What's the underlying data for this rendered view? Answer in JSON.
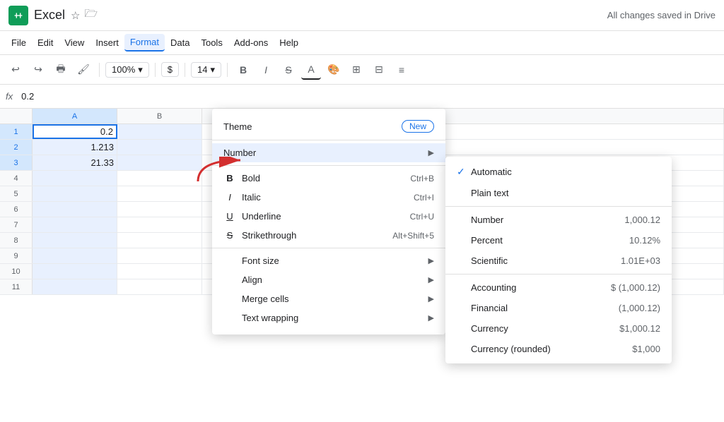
{
  "app": {
    "title": "Excel",
    "drive_status": "All changes saved in Drive",
    "icon_color": "#0f9d58"
  },
  "title_bar": {
    "app_name": "Excel",
    "star_icon": "☆",
    "folder_icon": "🗁"
  },
  "menu_bar": {
    "items": [
      "File",
      "Edit",
      "View",
      "Insert",
      "Format",
      "Data",
      "Tools",
      "Add-ons",
      "Help"
    ]
  },
  "toolbar": {
    "zoom": "100%",
    "currency_symbol": "$",
    "font_size": "14",
    "undo_icon": "↩",
    "redo_icon": "↪",
    "print_icon": "🖶",
    "paint_icon": "🖌",
    "bold": "B",
    "italic": "I",
    "strikethrough": "S",
    "underline": "A"
  },
  "formula_bar": {
    "fx": "fx",
    "cell_ref": "A1",
    "value": "0.2"
  },
  "spreadsheet": {
    "columns": [
      "A",
      "B"
    ],
    "rows": [
      {
        "num": 1,
        "a": "0.2",
        "b": ""
      },
      {
        "num": 2,
        "a": "1.213",
        "b": ""
      },
      {
        "num": 3,
        "a": "21.33",
        "b": ""
      },
      {
        "num": 4,
        "a": "",
        "b": ""
      },
      {
        "num": 5,
        "a": "",
        "b": ""
      },
      {
        "num": 6,
        "a": "",
        "b": ""
      },
      {
        "num": 7,
        "a": "",
        "b": ""
      },
      {
        "num": 8,
        "a": "",
        "b": ""
      },
      {
        "num": 9,
        "a": "",
        "b": ""
      },
      {
        "num": 10,
        "a": "",
        "b": ""
      },
      {
        "num": 11,
        "a": "",
        "b": ""
      }
    ]
  },
  "format_menu": {
    "items": [
      {
        "id": "theme",
        "label": "Theme",
        "badge": "New",
        "type": "badge"
      },
      {
        "id": "number",
        "label": "Number",
        "type": "submenu",
        "highlighted": true
      },
      {
        "id": "bold",
        "label": "Bold",
        "shortcut": "Ctrl+B",
        "icon": "B",
        "type": "item"
      },
      {
        "id": "italic",
        "label": "Italic",
        "shortcut": "Ctrl+I",
        "icon": "I",
        "type": "item"
      },
      {
        "id": "underline",
        "label": "Underline",
        "shortcut": "Ctrl+U",
        "icon": "U",
        "type": "item"
      },
      {
        "id": "strikethrough",
        "label": "Strikethrough",
        "shortcut": "Alt+Shift+5",
        "icon": "S",
        "type": "item"
      },
      {
        "id": "font_size",
        "label": "Font size",
        "type": "submenu"
      },
      {
        "id": "align",
        "label": "Align",
        "type": "submenu"
      },
      {
        "id": "merge_cells",
        "label": "Merge cells",
        "type": "submenu"
      },
      {
        "id": "text_wrapping",
        "label": "Text wrapping",
        "type": "submenu"
      }
    ]
  },
  "number_submenu": {
    "items": [
      {
        "id": "automatic",
        "label": "Automatic",
        "value": "",
        "checked": true
      },
      {
        "id": "plain_text",
        "label": "Plain text",
        "value": "",
        "checked": false
      },
      {
        "id": "number",
        "label": "Number",
        "value": "1,000.12",
        "checked": false
      },
      {
        "id": "percent",
        "label": "Percent",
        "value": "10.12%",
        "checked": false
      },
      {
        "id": "scientific",
        "label": "Scientific",
        "value": "1.01E+03",
        "checked": false
      },
      {
        "id": "accounting",
        "label": "Accounting",
        "value": "$ (1,000.12)",
        "checked": false
      },
      {
        "id": "financial",
        "label": "Financial",
        "value": "(1,000.12)",
        "checked": false
      },
      {
        "id": "currency",
        "label": "Currency",
        "value": "$1,000.12",
        "checked": false
      },
      {
        "id": "currency_rounded",
        "label": "Currency (rounded)",
        "value": "$1,000",
        "checked": false
      }
    ]
  }
}
